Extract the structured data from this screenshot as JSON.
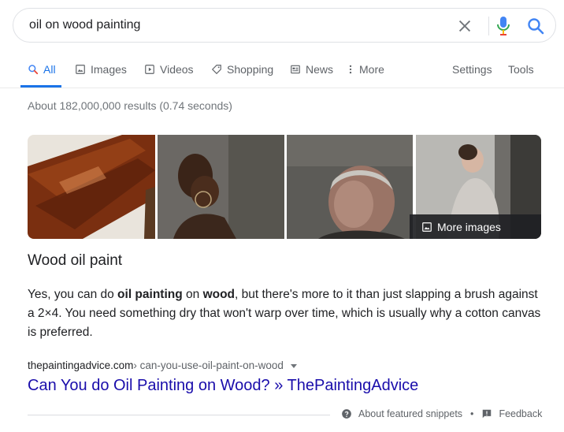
{
  "search": {
    "query": "oil on wood painting"
  },
  "icons": {
    "clear": "close-icon",
    "mic": "microphone-icon",
    "search": "search-icon"
  },
  "tabs": [
    {
      "label": "All",
      "icon": "search-icon",
      "active": true
    },
    {
      "label": "Images",
      "icon": "image-icon"
    },
    {
      "label": "Videos",
      "icon": "play-icon"
    },
    {
      "label": "Shopping",
      "icon": "tag-icon"
    },
    {
      "label": "News",
      "icon": "newspaper-icon"
    },
    {
      "label": "More",
      "icon": "more-vert-icon"
    },
    {
      "label": "Settings"
    },
    {
      "label": "Tools"
    }
  ],
  "stats": "About 182,000,000 results (0.74 seconds)",
  "images": {
    "more_label": "More images"
  },
  "snippet": {
    "title": "Wood oil paint",
    "body_parts": [
      {
        "text": "Yes, you can do ",
        "bold": false
      },
      {
        "text": "oil painting",
        "bold": true
      },
      {
        "text": " on ",
        "bold": false
      },
      {
        "text": "wood",
        "bold": true
      },
      {
        "text": ", but there's more to it than just slapping a brush against a 2×4. You need something dry that won't warp over time, which is usually why a cotton canvas is preferred.",
        "bold": false
      }
    ],
    "cite_domain": "thepaintingadvice.com",
    "cite_path": " › can-you-use-oil-paint-on-wood",
    "link_title": "Can You do Oil Painting on Wood? » ThePaintingAdvice"
  },
  "footer": {
    "about": "About featured snippets",
    "dot": "•",
    "feedback": "Feedback"
  },
  "colors": {
    "link": "#1a0dab",
    "accent": "#1a73e8",
    "muted": "#70757a"
  }
}
